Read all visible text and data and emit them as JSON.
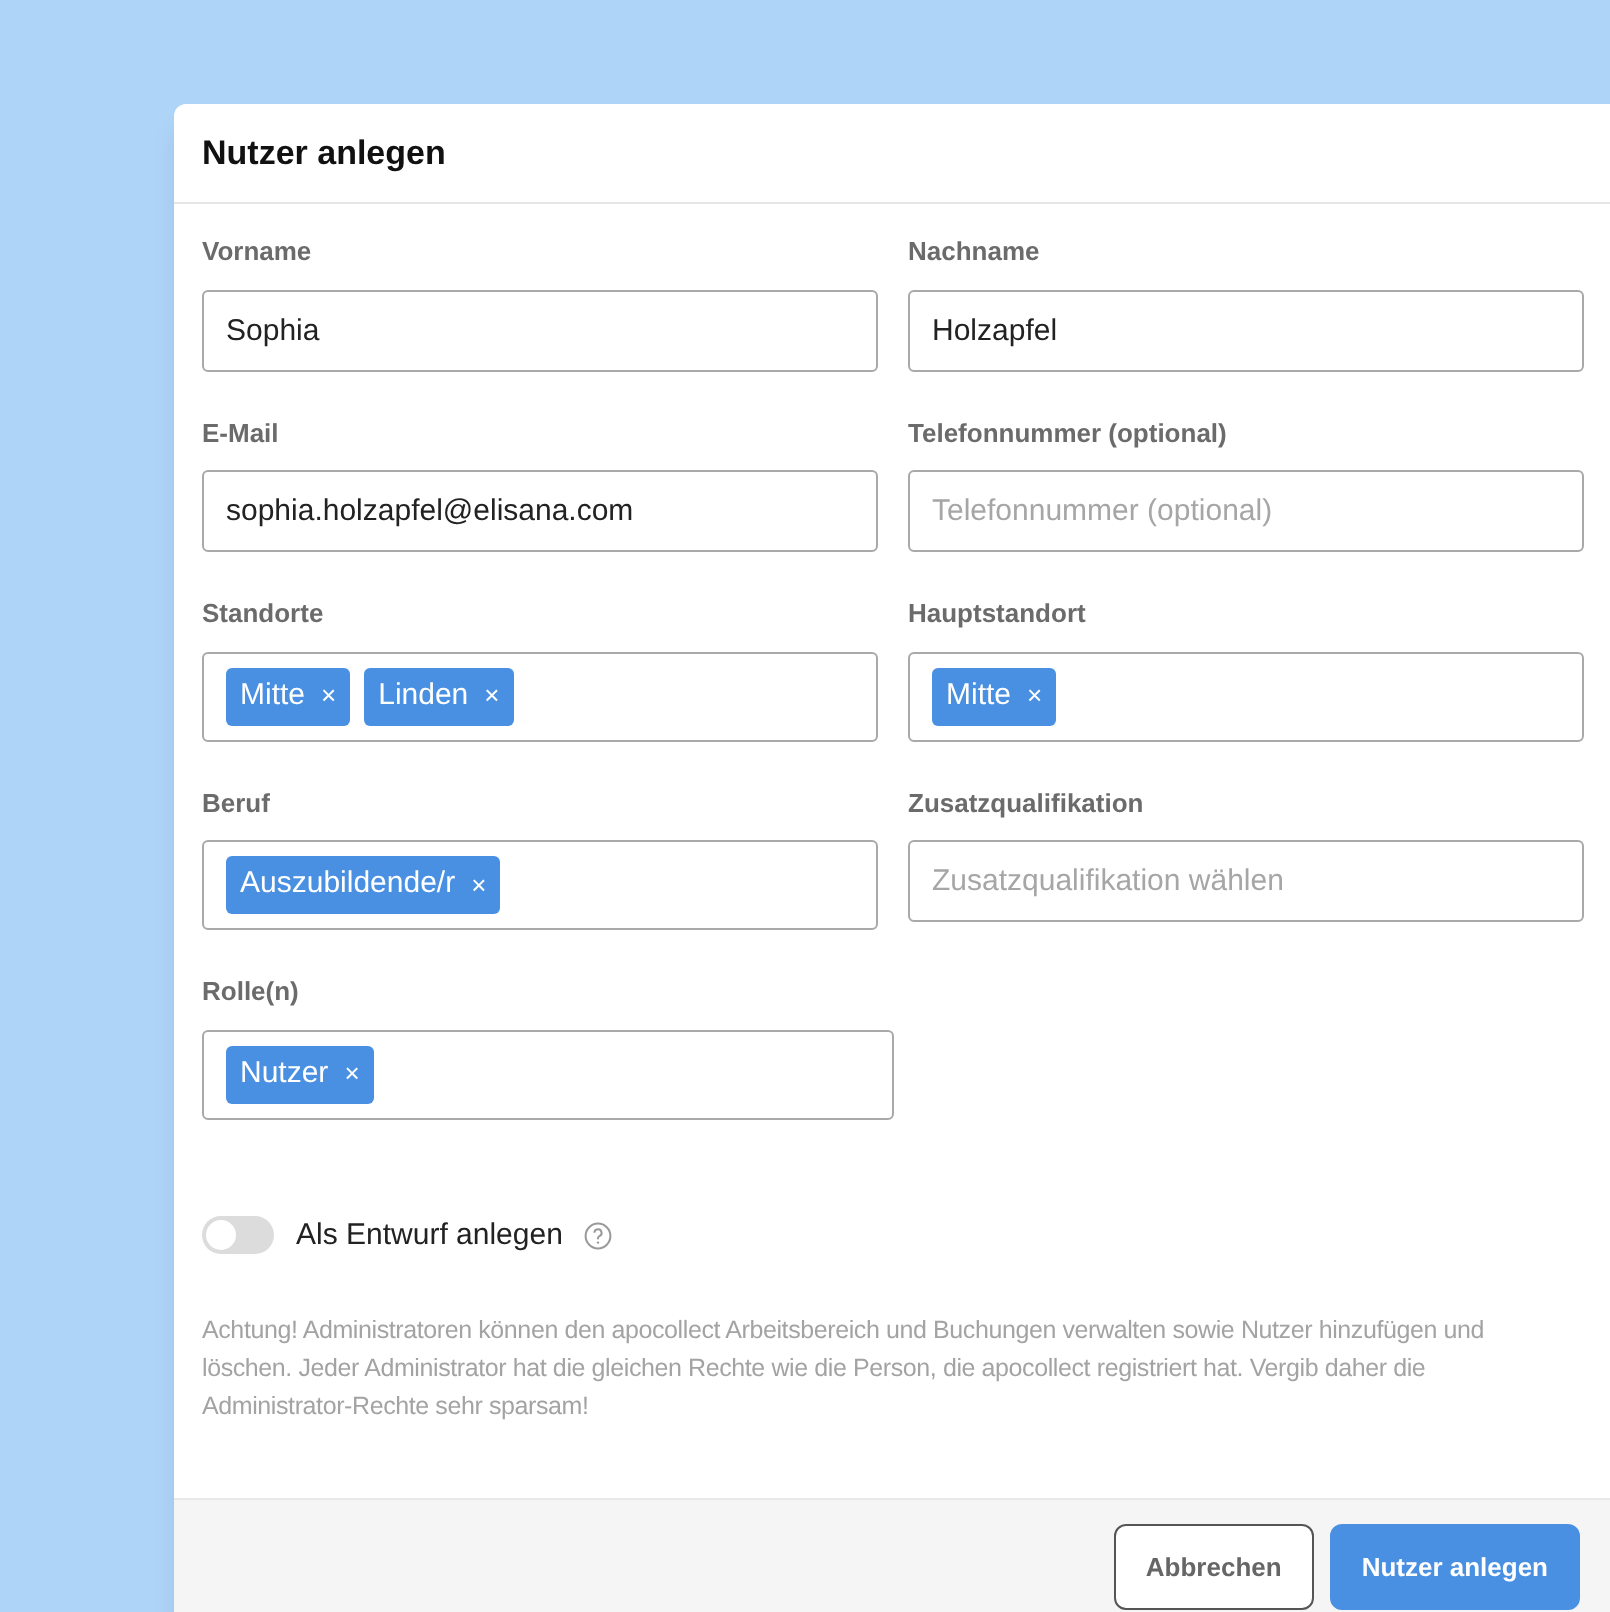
{
  "dialog": {
    "title": "Nutzer anlegen"
  },
  "rows": [
    [
      {
        "kind": "text",
        "label": "Vorname",
        "value": "Sophia"
      },
      {
        "kind": "text",
        "label": "Nachname",
        "value": "Holzapfel"
      }
    ],
    [
      {
        "kind": "text",
        "label": "E-Mail",
        "value": "sophia.holzapfel@elisana.com"
      },
      {
        "kind": "text",
        "label": "Telefonnummer (optional)",
        "placeholder": "Telefonnummer (optional)"
      }
    ],
    [
      {
        "kind": "tags",
        "label": "Standorte",
        "tags": [
          {
            "label": "Mitte",
            "remove": "×"
          },
          {
            "label": "Linden",
            "remove": "×"
          }
        ]
      },
      {
        "kind": "tags",
        "label": "Hauptstandort",
        "tags": [
          {
            "label": "Mitte",
            "remove": "×"
          }
        ]
      }
    ],
    [
      {
        "kind": "tags",
        "label": "Beruf",
        "tags": [
          {
            "label": "Auszubildende/r",
            "remove": "×"
          }
        ]
      },
      {
        "kind": "select",
        "label": "Zusatzqualifikation",
        "placeholder": "Zusatzqualifikation wählen"
      }
    ],
    [
      {
        "kind": "tags",
        "label": "Rolle(n)",
        "tags": [
          {
            "label": "Nutzer",
            "remove": "×"
          }
        ]
      }
    ]
  ],
  "draft_toggle": {
    "label": "Als Entwurf anlegen",
    "on": false
  },
  "notice": "Achtung! Administratoren können den apocollect Arbeitsbereich und Buchungen verwalten sowie Nutzer hinzufügen und löschen. Jeder Administrator hat die gleichen Rechte wie die Person, die apocollect registriert hat. Vergib daher die Administrator-Rechte sehr sparsam!",
  "buttons": [
    {
      "label": "Abbrechen",
      "kind": "secondary"
    },
    {
      "label": "Nutzer anlegen",
      "kind": "primary"
    }
  ]
}
